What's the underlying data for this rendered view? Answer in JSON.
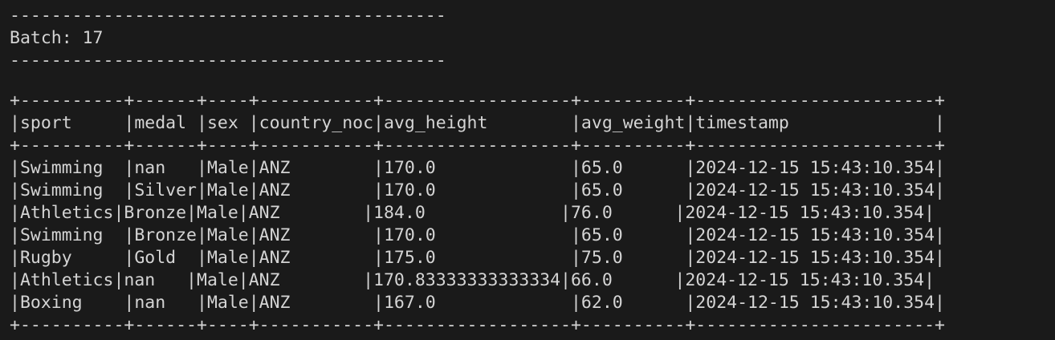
{
  "terminal": {
    "separator_top": "------------------------------------------",
    "batch_label": "Batch: 17",
    "separator_bottom": "------------------------------------------",
    "table": {
      "border": "+----------+------+----+-----------+------------------+----------+-----------------------+",
      "header": "|sport     |medal |sex |country_noc|avg_height        |avg_weight|timestamp              |",
      "columns": [
        "sport",
        "medal",
        "sex",
        "country_noc",
        "avg_height",
        "avg_weight",
        "timestamp"
      ],
      "rows": [
        "|Swimming  |nan   |Male|ANZ        |170.0             |65.0      |2024-12-15 15:43:10.354|",
        "|Swimming  |Silver|Male|ANZ        |170.0             |65.0      |2024-12-15 15:43:10.354|",
        "|Athletics|Bronze|Male|ANZ        |184.0             |76.0      |2024-12-15 15:43:10.354|",
        "|Swimming  |Bronze|Male|ANZ        |170.0             |65.0      |2024-12-15 15:43:10.354|",
        "|Rugby     |Gold  |Male|ANZ        |175.0             |75.0      |2024-12-15 15:43:10.354|",
        "|Athletics|nan   |Male|ANZ        |170.83333333333334|66.0      |2024-12-15 15:43:10.354|",
        "|Boxing    |nan   |Male|ANZ        |167.0             |62.0      |2024-12-15 15:43:10.354|"
      ]
    },
    "colors": {
      "background": "#1a1a1a",
      "text": "#d4d4d4"
    }
  }
}
